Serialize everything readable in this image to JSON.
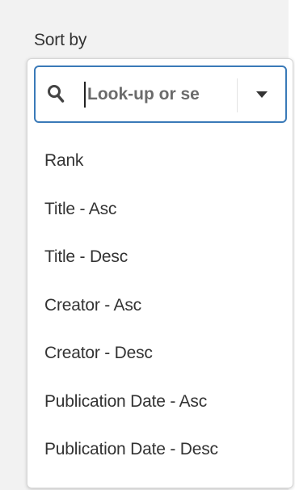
{
  "sort": {
    "label": "Sort by",
    "search": {
      "placeholder": "Look-up or se",
      "value": ""
    },
    "icons": {
      "search": "search-icon",
      "dropdown": "chevron-down-icon"
    },
    "options": [
      "Rank",
      "Title - Asc",
      "Title - Desc",
      "Creator - Asc",
      "Creator - Desc",
      "Publication Date - Asc",
      "Publication Date - Desc"
    ]
  },
  "colors": {
    "focus_border": "#3a7ab8",
    "text": "#333333",
    "background": "#f2f2f2"
  }
}
